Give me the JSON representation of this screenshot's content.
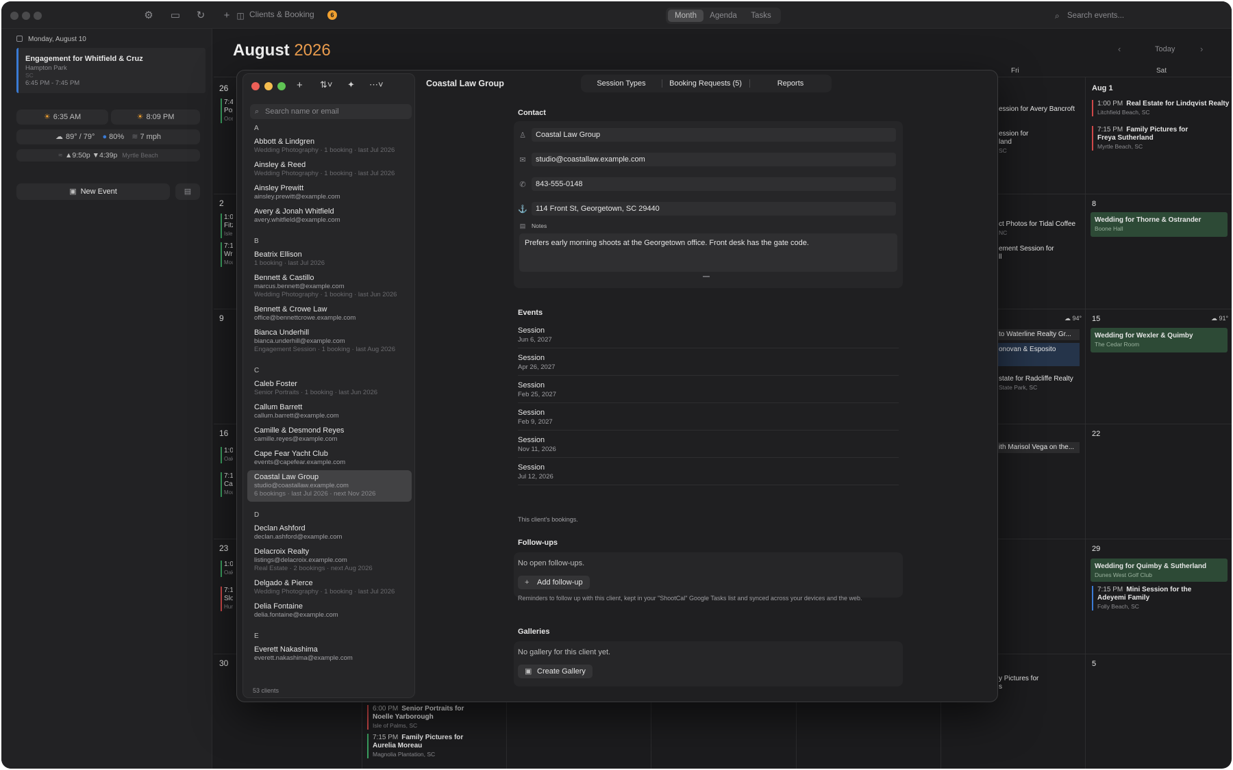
{
  "toolbar": {
    "window_title": "Clients & Booking",
    "badge": "6",
    "views": [
      "Month",
      "Agenda",
      "Tasks"
    ],
    "active_view": "Month",
    "search_placeholder": "Search events..."
  },
  "sidebar": {
    "date": "Monday, August 10",
    "event": {
      "title": "Engagement for Whitfield & Cruz",
      "location": "Hampton Park",
      "region": "SC",
      "time": "6:45 PM - 7:45 PM"
    },
    "sunrise": "6:35 AM",
    "sunset": "8:09 PM",
    "weather": "89° / 79°",
    "rain": "80%",
    "wind": "7 mph",
    "tide_high": "9:50p",
    "tide_low": "4:39p",
    "tide_place": "Myrtle Beach",
    "new_event": "New Event"
  },
  "calendar": {
    "month": "August",
    "year": "2026",
    "today": "Today",
    "dow": [
      "Fri",
      "Sat"
    ],
    "week_numbers": [
      "26",
      "2",
      "9",
      "16",
      "23",
      "30"
    ],
    "sat_numbers": [
      "Aug 1",
      "8",
      "15",
      "22",
      "29",
      "5"
    ],
    "edge_events": [
      "7:4",
      "Pop",
      "Oce",
      "1:0",
      "Fitz",
      "Isle",
      "7:1",
      "Wre",
      "Mou",
      "1:0",
      "Oak",
      "7:1",
      "Cas",
      "Mou",
      "1:0",
      "Oak",
      "7:1",
      "Slo",
      "Hun"
    ],
    "fri_events": [
      "ession for Avery Bancroft",
      "ession for",
      "land",
      "SC",
      "ct Photos for Tidal Coffee",
      "NC",
      "ement Session for",
      "ll",
      "to Waterline Realty Gr...",
      "onovan & Esposito",
      "state for Radcliffe Realty",
      "State Park, SC",
      "ith Marisol Vega on the...",
      "y Pictures for",
      "s"
    ],
    "weather_fri": "94°",
    "weather_sat": "91°",
    "sat_events": {
      "a1": {
        "time": "1:00 PM",
        "title": "Real Estate for Lindqvist Realty",
        "loc": "Litchfield Beach, SC"
      },
      "a2": {
        "time": "7:15 PM",
        "title": "Family Pictures for",
        "title2": "Freya Sutherland",
        "loc": "Myrtle Beach, SC"
      },
      "b1": {
        "title": "Wedding for Thorne & Ostrander",
        "loc": "Boone Hall"
      },
      "c1": {
        "title": "Wedding for Wexler & Quimby",
        "loc": "The Cedar Room"
      },
      "d1": {
        "title": "Wedding for Quimby & Sutherland",
        "loc": "Dunes West Golf Club"
      },
      "d2": {
        "time": "7:15 PM",
        "title": "Mini Session for the",
        "title2": "Adeyemi Family",
        "loc": "Folly Beach, SC"
      }
    },
    "bottom_events": {
      "e1": {
        "time": "6:00 PM",
        "title": "Senior Portraits for",
        "title2": "Noelle Yarborough",
        "loc": "Isle of Palms, SC"
      },
      "e2": {
        "time": "7:15 PM",
        "title": "Family Pictures for",
        "title2": "Aurelia Moreau",
        "loc": "Magnolia Plantation, SC"
      }
    }
  },
  "clients_window": {
    "title": "Coastal Law Group",
    "tabs": [
      "Session Types",
      "Booking Requests (5)",
      "Reports"
    ],
    "search_placeholder": "Search name or email",
    "groups": [
      {
        "letter": "A",
        "clients": [
          {
            "name": "Abbott & Lindgren",
            "email": "",
            "meta": "Wedding Photography · 1 booking · last Jul 2026"
          },
          {
            "name": "Ainsley & Reed",
            "email": "",
            "meta": "Wedding Photography · 1 booking · last Jul 2026"
          },
          {
            "name": "Ainsley Prewitt",
            "email": "ainsley.prewitt@example.com",
            "meta": ""
          },
          {
            "name": "Avery & Jonah Whitfield",
            "email": "avery.whitfield@example.com",
            "meta": ""
          }
        ]
      },
      {
        "letter": "B",
        "clients": [
          {
            "name": "Beatrix Ellison",
            "email": "",
            "meta": "1 booking · last Jul 2026"
          },
          {
            "name": "Bennett & Castillo",
            "email": "marcus.bennett@example.com",
            "meta": "Wedding Photography · 1 booking · last Jun 2026"
          },
          {
            "name": "Bennett & Crowe Law",
            "email": "office@bennettcrowe.example.com",
            "meta": ""
          },
          {
            "name": "Bianca Underhill",
            "email": "bianca.underhill@example.com",
            "meta": "Engagement Session · 1 booking · last Aug 2026"
          }
        ]
      },
      {
        "letter": "C",
        "clients": [
          {
            "name": "Caleb Foster",
            "email": "",
            "meta": "Senior Portraits · 1 booking · last Jun 2026"
          },
          {
            "name": "Callum Barrett",
            "email": "callum.barrett@example.com",
            "meta": ""
          },
          {
            "name": "Camille & Desmond Reyes",
            "email": "camille.reyes@example.com",
            "meta": ""
          },
          {
            "name": "Cape Fear Yacht Club",
            "email": "events@capefear.example.com",
            "meta": ""
          },
          {
            "name": "Coastal Law Group",
            "email": "studio@coastallaw.example.com",
            "meta": "6 bookings · last Jul 2026 · next Nov 2026",
            "selected": true
          }
        ]
      },
      {
        "letter": "D",
        "clients": [
          {
            "name": "Declan Ashford",
            "email": "declan.ashford@example.com",
            "meta": ""
          },
          {
            "name": "Delacroix Realty",
            "email": "listings@delacroix.example.com",
            "meta": "Real Estate · 2 bookings · next Aug 2026"
          },
          {
            "name": "Delgado & Pierce",
            "email": "",
            "meta": "Wedding Photography · 1 booking · last Jul 2026"
          },
          {
            "name": "Delia Fontaine",
            "email": "delia.fontaine@example.com",
            "meta": ""
          }
        ]
      },
      {
        "letter": "E",
        "clients": [
          {
            "name": "Everett Nakashima",
            "email": "everett.nakashima@example.com",
            "meta": ""
          }
        ]
      }
    ],
    "count": "53 clients",
    "contact": {
      "section": "Contact",
      "name": "Coastal Law Group",
      "email": "studio@coastallaw.example.com",
      "phone": "843-555-0148",
      "address": "114 Front St, Georgetown, SC 29440",
      "notes_label": "Notes",
      "notes": "Prefers early morning shoots at the Georgetown office. Front desk has the gate code."
    },
    "events": {
      "section": "Events",
      "items": [
        {
          "name": "Session",
          "date": "Jun 6, 2027"
        },
        {
          "name": "Session",
          "date": "Apr 26, 2027"
        },
        {
          "name": "Session",
          "date": "Feb 25, 2027"
        },
        {
          "name": "Session",
          "date": "Feb 9, 2027"
        },
        {
          "name": "Session",
          "date": "Nov 11, 2026"
        },
        {
          "name": "Session",
          "date": "Jul 12, 2026"
        }
      ],
      "footer": "This client's bookings."
    },
    "followups": {
      "section": "Follow-ups",
      "empty": "No open follow-ups.",
      "add": "Add follow-up",
      "note": "Reminders to follow up with this client, kept in your \"ShootCal\" Google Tasks list and synced across your devices and the web."
    },
    "galleries": {
      "section": "Galleries",
      "empty": "No gallery for this client yet.",
      "create": "Create Gallery"
    }
  },
  "colors": {
    "accent": "#f0a050",
    "green": "#3aa060",
    "red": "#d04848",
    "blue": "#3a7bd5"
  }
}
